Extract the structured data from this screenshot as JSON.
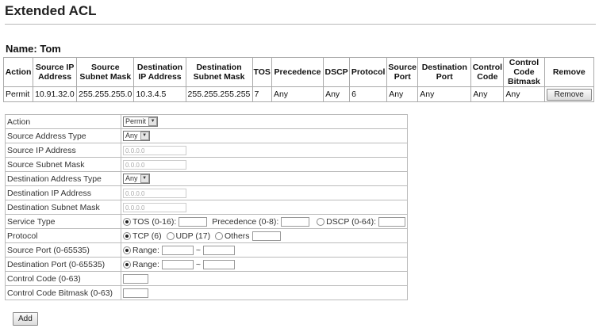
{
  "page": {
    "title": "Extended ACL"
  },
  "acl_name": "Name: Tom",
  "table": {
    "headers": [
      "Action",
      "Source IP Address",
      "Source Subnet Mask",
      "Destination IP Address",
      "Destination Subnet Mask",
      "TOS",
      "Precedence",
      "DSCP",
      "Protocol",
      "Source Port",
      "Destination Port",
      "Control Code",
      "Control Code Bitmask",
      "Remove"
    ],
    "rows": [
      {
        "cells": [
          "Permit",
          "10.91.32.0",
          "255.255.255.0",
          "10.3.4.5",
          "255.255.255.255",
          "7",
          "Any",
          "Any",
          "6",
          "Any",
          "Any",
          "Any",
          "Any"
        ],
        "remove_label": "Remove"
      }
    ]
  },
  "form": {
    "action": {
      "label": "Action",
      "value": "Permit"
    },
    "src_addr_type": {
      "label": "Source Address Type",
      "value": "Any"
    },
    "src_ip": {
      "label": "Source IP Address",
      "value": "0.0.0.0"
    },
    "src_mask": {
      "label": "Source Subnet Mask",
      "value": "0.0.0.0"
    },
    "dst_addr_type": {
      "label": "Destination Address Type",
      "value": "Any"
    },
    "dst_ip": {
      "label": "Destination IP Address",
      "value": "0.0.0.0"
    },
    "dst_mask": {
      "label": "Destination Subnet Mask",
      "value": "0.0.0.0"
    },
    "service_type": {
      "label": "Service Type",
      "tos": "TOS (0-16):",
      "precedence": "Precedence (0-8):",
      "dscp": "DSCP (0-64):"
    },
    "protocol": {
      "label": "Protocol",
      "tcp": "TCP (6)",
      "udp": "UDP (17)",
      "others": "Others"
    },
    "src_port": {
      "label": "Source Port (0-65535)",
      "range": "Range:",
      "sep": "~"
    },
    "dst_port": {
      "label": "Destination Port (0-65535)",
      "range": "Range:",
      "sep": "~"
    },
    "ctrl_code": {
      "label": "Control Code (0-63)"
    },
    "ctrl_bitmask": {
      "label": "Control Code Bitmask (0-63)"
    }
  },
  "add_label": "Add"
}
